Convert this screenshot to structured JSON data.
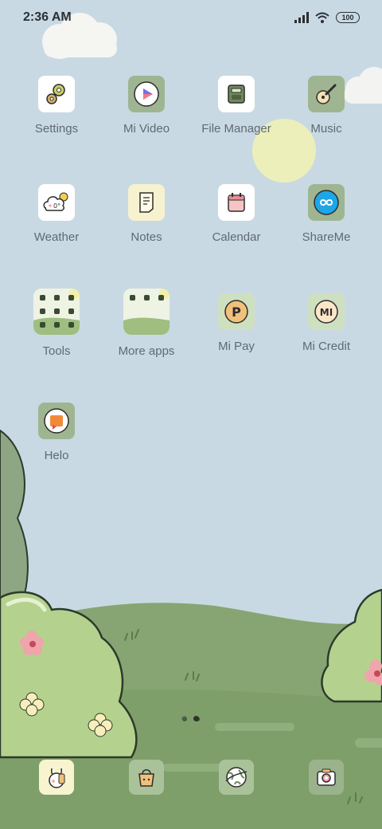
{
  "status_bar": {
    "time": "2:36 AM",
    "battery": "100",
    "icons": [
      "signal-icon",
      "wifi-icon",
      "battery-icon"
    ]
  },
  "apps": [
    {
      "label": "Settings",
      "icon": "gear-icon"
    },
    {
      "label": "Mi Video",
      "icon": "play-icon"
    },
    {
      "label": "File Manager",
      "icon": "folder-icon"
    },
    {
      "label": "Music",
      "icon": "guitar-icon"
    },
    {
      "label": "Weather",
      "icon": "cloud-sun-icon",
      "temp": "0°"
    },
    {
      "label": "Notes",
      "icon": "notepad-icon"
    },
    {
      "label": "Calendar",
      "icon": "calendar-icon"
    },
    {
      "label": "ShareMe",
      "icon": "infinity-icon"
    },
    {
      "label": "Tools",
      "icon": "folder-grid-icon"
    },
    {
      "label": "More apps",
      "icon": "folder-grid-icon"
    },
    {
      "label": "Mi Pay",
      "icon": "pay-icon",
      "glyph": "P"
    },
    {
      "label": "Mi Credit",
      "icon": "credit-icon",
      "glyph": "MI"
    },
    {
      "label": "Helo",
      "icon": "helo-icon"
    }
  ],
  "dock": [
    {
      "icon": "phone-bunny-icon"
    },
    {
      "icon": "messages-bag-icon"
    },
    {
      "icon": "browser-globe-icon"
    },
    {
      "icon": "camera-icon"
    }
  ],
  "page_indicator": {
    "pages": 2,
    "current": 2
  },
  "colors": {
    "sky": "#c9d9e3",
    "hills": "#7f9f6a",
    "bush": "#b4d28e",
    "sun": "#eef0b7",
    "label": "#5f6a73"
  }
}
